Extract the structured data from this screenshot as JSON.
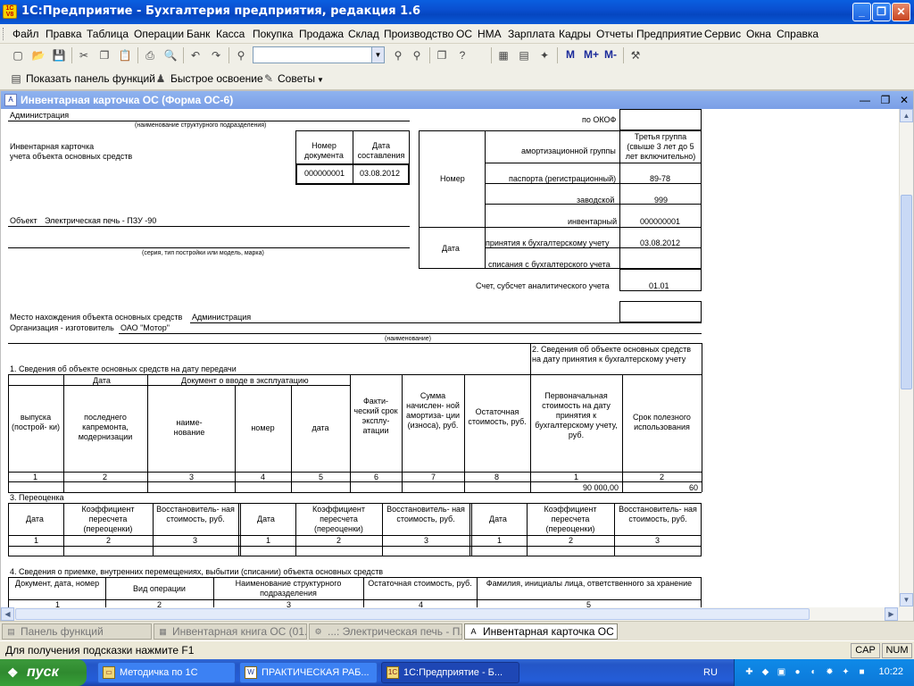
{
  "window": {
    "title": "1С:Предприятие - Бухгалтерия предприятия, редакция 1.6",
    "app_icon": "1C\nV8"
  },
  "menu": [
    "Файл",
    "Правка",
    "Таблица",
    "Операции",
    "Банк",
    "Касса",
    "Покупка",
    "Продажа",
    "Склад",
    "Производство",
    "ОС",
    "НМА",
    "Зарплата",
    "Кадры",
    "Отчеты",
    "Предприятие",
    "Сервис",
    "Окна",
    "Справка"
  ],
  "toolbar2": {
    "panel_label": "Показать панель функций",
    "quick_label": "Быстрое освоение",
    "tips_label": "Советы"
  },
  "toolbar1": {
    "m1": "M",
    "m2": "M+",
    "m3": "M-"
  },
  "child": {
    "title": "Инвентарная карточка ОС (Форма ОС-6)"
  },
  "form": {
    "org_unit": "Администрация",
    "org_unit_caption": "(наименование структурного подразделения)",
    "card_title_1": "Инвентарная карточка",
    "card_title_2": "учета объекта основных средств",
    "doc_num_header": "Номер документа",
    "doc_date_header": "Дата составления",
    "doc_num": "000000001",
    "doc_date": "03.08.2012",
    "okof_label": "по ОКОФ",
    "amort_label": "амортизационной группы",
    "amort_value": "Третья группа (свыше 3 лет до 5 лет включительно)",
    "number_label": "Номер",
    "passport_label": "паспорта (регистрационный)",
    "passport_value": "89-78",
    "factory_label": "заводской",
    "factory_value": "999",
    "inventory_label": "инвентарный",
    "inventory_value": "000000001",
    "date_label": "Дата",
    "acceptance_label": "принятия к бухгалтерскому учету",
    "acceptance_value": "03.08.2012",
    "writeoff_label": "списания с бухгалтерского учета",
    "account_label": "Счет, субсчет аналитического учета",
    "account_value": "01.01",
    "object_label": "Объект",
    "object_value": "Электрическая печь - ПЗУ -90",
    "object_caption": "(серия, тип постройки или модель, марка)",
    "location_label": "Место нахождения объекта основных средств",
    "location_value": "Администрация",
    "manufacturer_label": "Организация - изготовитель",
    "manufacturer_value": "ОАО \"Мотор\"",
    "manufacturer_caption": "(наименование)",
    "s1_title": "1. Сведения об объекте основных средств на дату передачи",
    "s2_title": "2. Сведения об объекте основных средств на дату принятия к бухгалтерскому учету",
    "s1_date": "Дата",
    "s1_doc": "Документ о вводе в эксплуатацию",
    "s1_cols": [
      "выпуска (построй- ки)",
      "последнего капремонта, модернизации",
      "наиме- нование",
      "номер",
      "дата",
      "Факти- ческий срок эксплу- атации",
      "Сумма начислен- ной амортиза- ции (износа), руб.",
      "Остаточная стоимость, руб.",
      "Первоначальная стоимость на дату принятия к бухгалтерскому учету, руб.",
      "Срок полезного использования"
    ],
    "s1_nums": [
      "1",
      "2",
      "3",
      "4",
      "5",
      "6",
      "7",
      "8",
      "1",
      "2"
    ],
    "s2_cost": "90 000,00",
    "s2_term": "60",
    "s3_title": "3. Переоценка",
    "s3_cols": [
      "Дата",
      "Коэффициент пересчета (переоценки)",
      "Восстановитель- ная стоимость, руб."
    ],
    "s3_nums": [
      "1",
      "2",
      "3"
    ],
    "s4_title": "4. Сведения о приемке, внутренних перемещениях, выбытии (списании) объекта основных средств",
    "s4_cols": [
      "Документ, дата, номер",
      "Вид операции",
      "Наименование структурного подразделения",
      "Остаточная стоимость, руб.",
      "Фамилия, инициалы лица, ответственного за хранение"
    ],
    "s4_nums": [
      "1",
      "2",
      "3",
      "4",
      "5"
    ]
  },
  "mdi_tabs": [
    {
      "label": "Панель функций",
      "active": false
    },
    {
      "label": "Инвентарная книга ОС (01....",
      "active": false
    },
    {
      "label": "...: Электрическая печь - П...",
      "active": false
    },
    {
      "label": "Инвентарная карточка ОС (...",
      "active": true
    }
  ],
  "status": {
    "hint": "Для получения подсказки нажмите F1",
    "cap": "CAP",
    "num": "NUM"
  },
  "taskbar": {
    "start": "пуск",
    "tasks": [
      "Методичка по 1С",
      "ПРАКТИЧЕСКАЯ РАБ...",
      "1С:Предприятие - Б..."
    ],
    "lang": "RU",
    "clock": "10:22"
  }
}
